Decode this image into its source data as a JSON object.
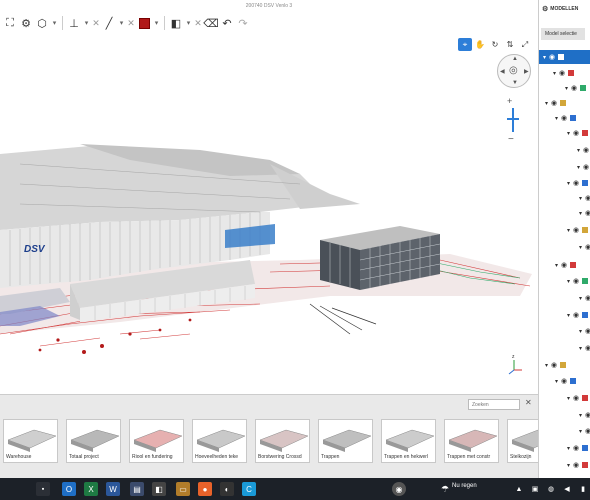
{
  "window": {
    "title": "200740 DSV Venlo 3"
  },
  "toolbar": {
    "items": [
      "fit-view-icon",
      "model-tree-icon",
      "cube-view-icon",
      "measure-icon",
      "draw-line-icon",
      "color-icon",
      "section-icon",
      "clear-icon",
      "undo-icon",
      "redo-icon"
    ]
  },
  "viewport": {
    "building_logo": "DSV",
    "view_modes": [
      "select-icon",
      "pan-icon",
      "orbit-icon",
      "axis-icon",
      "fullscreen-icon"
    ]
  },
  "bottom": {
    "search_placeholder": "Zoeken",
    "views": [
      {
        "label": "Warehouse"
      },
      {
        "label": "Totaal project"
      },
      {
        "label": "Riool en fundering"
      },
      {
        "label": "Hoeveelheden teke"
      },
      {
        "label": "Borstwering Crossd"
      },
      {
        "label": "Trappen"
      },
      {
        "label": "Trappen en hekwerl"
      },
      {
        "label": "Trappen met constr"
      },
      {
        "label": "Stelkozijn"
      }
    ]
  },
  "panel": {
    "title": "MODELLEN",
    "tab": "Model selectie"
  },
  "taskbar": {
    "weather": "Nu regen"
  },
  "colors": {
    "accent": "#1f6fc6",
    "red_swatch": "#b01818",
    "taskbar": "#1c2128"
  }
}
